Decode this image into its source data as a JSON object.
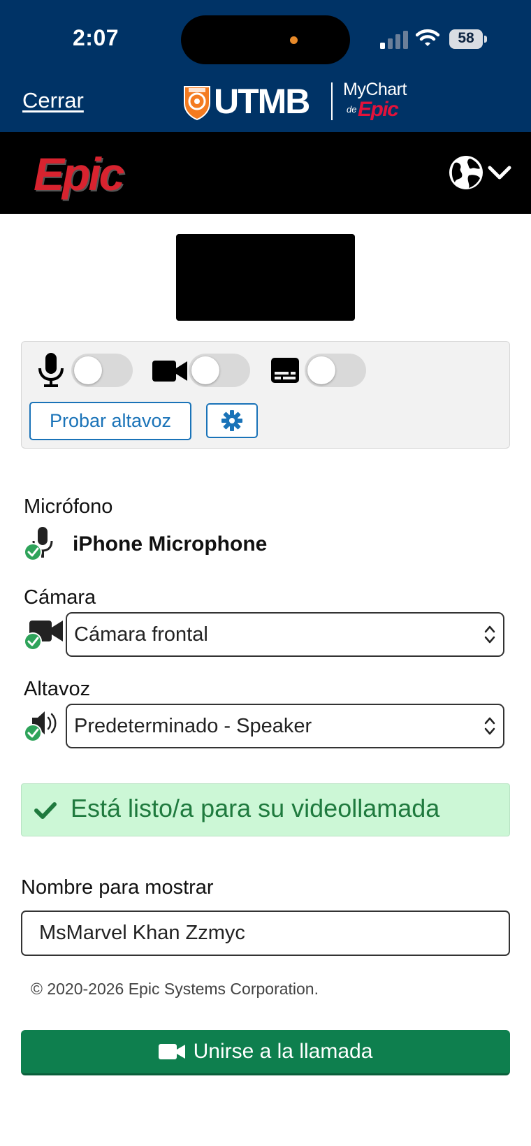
{
  "status_bar": {
    "time": "2:07",
    "battery": "58"
  },
  "header": {
    "close_label": "Cerrar",
    "org_name": "UTMB",
    "mychart_label": "MyChart",
    "mychart_de": "de",
    "mychart_epic": "Epic"
  },
  "brand_bar": {
    "logo_text": "Epic"
  },
  "controls": {
    "test_speaker_label": "Probar altavoz",
    "mic_toggle_on": false,
    "camera_toggle_on": false,
    "captions_toggle_on": false
  },
  "devices": {
    "microphone": {
      "label": "Micrófono",
      "value": "iPhone Microphone"
    },
    "camera": {
      "label": "Cámara",
      "value": "Cámara frontal"
    },
    "speaker": {
      "label": "Altavoz",
      "value": "Predeterminado - Speaker"
    }
  },
  "ready_message": "Está listo/a para su videollamada",
  "display_name": {
    "label": "Nombre para mostrar",
    "value": "MsMarvel Khan Zzmyc"
  },
  "copyright": "© 2020-2026 Epic Systems Corporation.",
  "join_button_label": "Unirse a la llamada",
  "colors": {
    "header_bg": "#003366",
    "brand_bar_bg": "#000000",
    "link_blue": "#1a73b8",
    "success_green": "#1f7a3e",
    "join_green": "#0e7f4e",
    "epic_red": "#d8232f"
  }
}
